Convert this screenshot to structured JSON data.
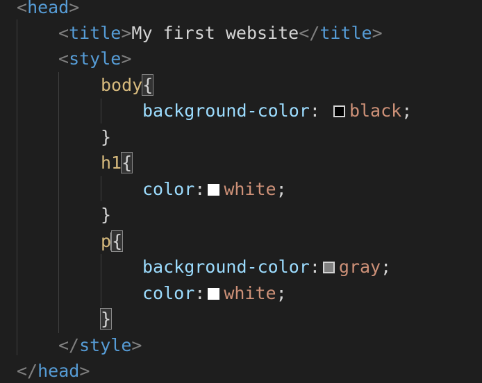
{
  "code": {
    "head_open_tag": "head",
    "head_close_tag": "head",
    "title_tag": "title",
    "title_text": "My first website",
    "style_tag": "style",
    "rules": [
      {
        "selector": "body",
        "declarations": [
          {
            "property": "background-color",
            "value": "black",
            "swatch_color": "#000000"
          }
        ]
      },
      {
        "selector": "h1",
        "declarations": [
          {
            "property": "color",
            "value": "white",
            "swatch_color": "#ffffff"
          }
        ]
      },
      {
        "selector": "p",
        "declarations": [
          {
            "property": "background-color",
            "value": "gray",
            "swatch_color": "#808080"
          },
          {
            "property": "color",
            "value": "white",
            "swatch_color": "#ffffff"
          }
        ]
      }
    ],
    "open_brace": "{",
    "close_brace": "}",
    "lt": "<",
    "gt": ">",
    "lt_slash": "</",
    "colon_space": ": ",
    "colon": ":",
    "semicolon": ";"
  },
  "theme": {
    "background": "#1e1e1e",
    "tag_color": "#569cd6",
    "selector_color": "#d7ba7d",
    "property_color": "#9cdcfe",
    "value_color": "#ce9178",
    "punctuation_color": "#808080"
  }
}
